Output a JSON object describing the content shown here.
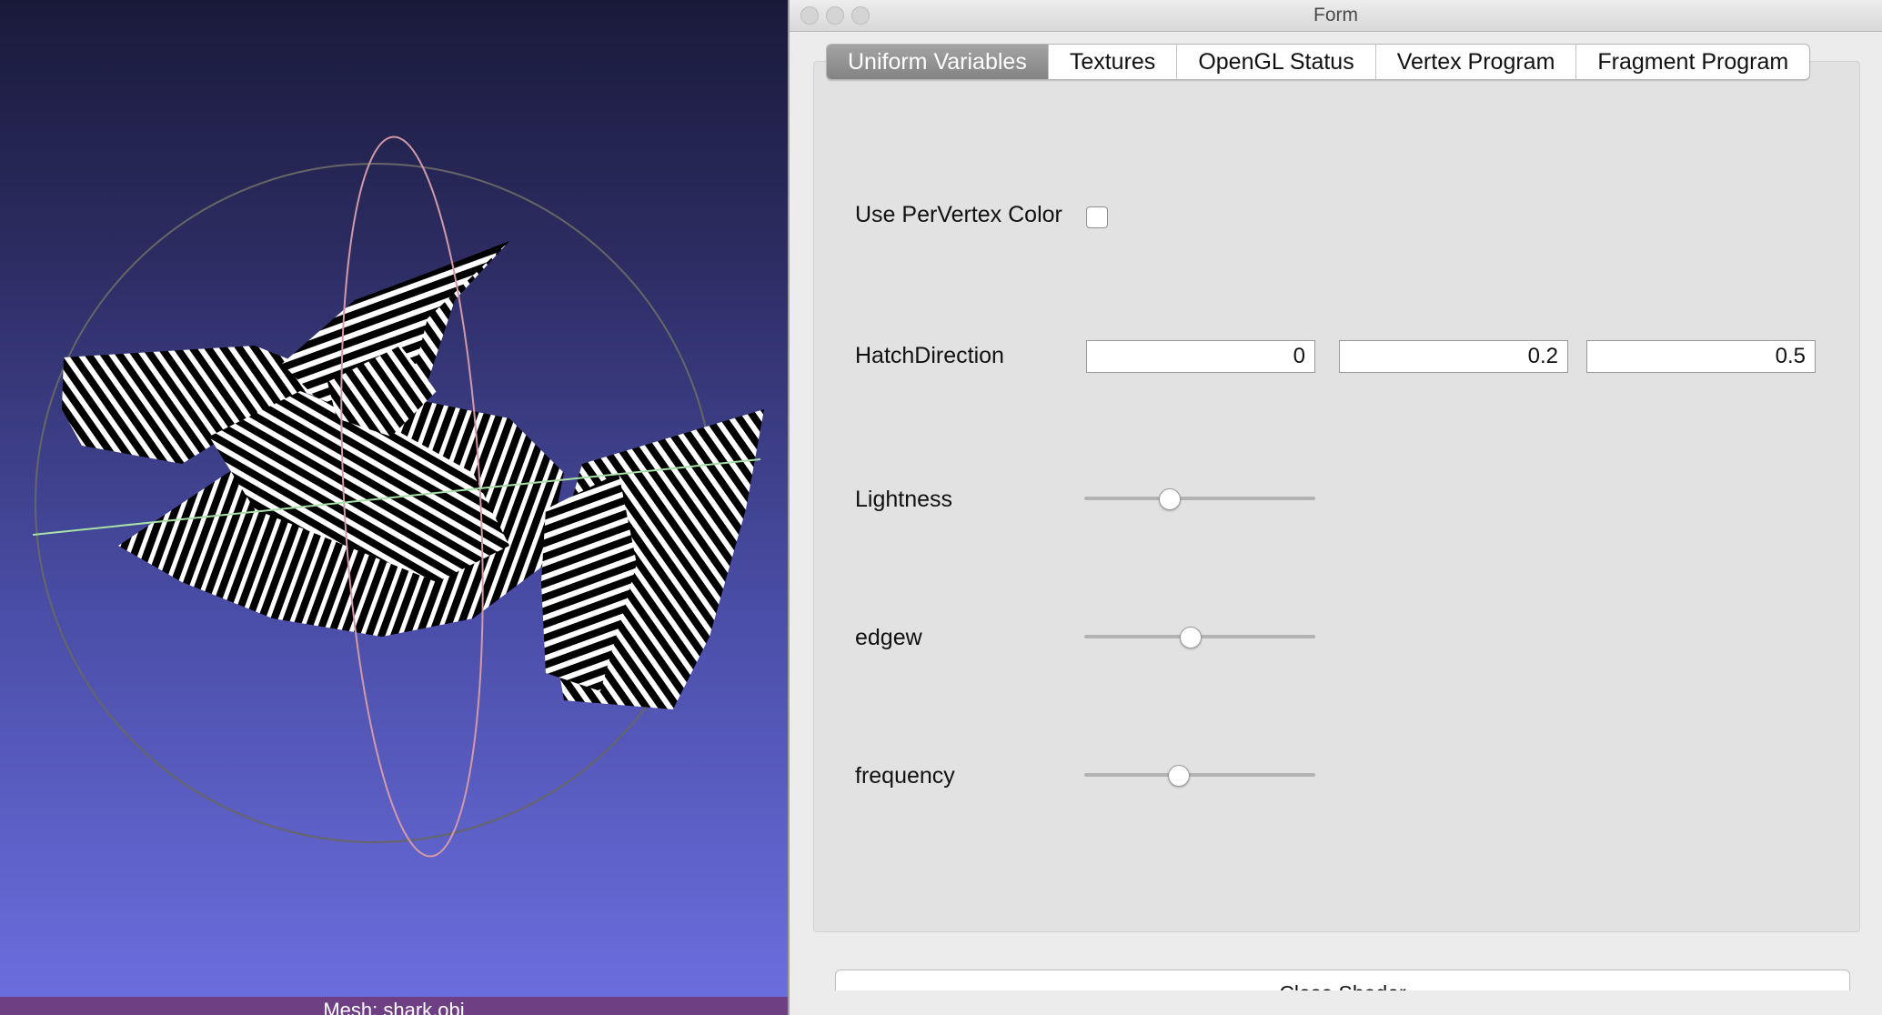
{
  "viewport": {
    "status_text": "Mesh: shark.obj"
  },
  "window": {
    "title": "Form"
  },
  "tabs": [
    {
      "label": "Uniform Variables",
      "active": true
    },
    {
      "label": "Textures",
      "active": false
    },
    {
      "label": "OpenGL Status",
      "active": false
    },
    {
      "label": "Vertex Program",
      "active": false
    },
    {
      "label": "Fragment Program",
      "active": false
    }
  ],
  "uniforms": {
    "per_vertex": {
      "label": "Use PerVertex Color",
      "checked": false
    },
    "hatch_direction": {
      "label": "HatchDirection",
      "values": [
        "0",
        "0.2",
        "0.5"
      ]
    },
    "lightness": {
      "label": "Lightness",
      "value": 0.37
    },
    "edgew": {
      "label": "edgew",
      "value": 0.46
    },
    "frequency": {
      "label": "frequency",
      "value": 0.41
    }
  },
  "close_button": {
    "label": "Close Shader"
  },
  "colors": {
    "active_tab": "#8f8f8f",
    "status_bar": "#6e3f83",
    "viewport_top": "#191a3a",
    "viewport_bottom": "#6c6fe0"
  }
}
